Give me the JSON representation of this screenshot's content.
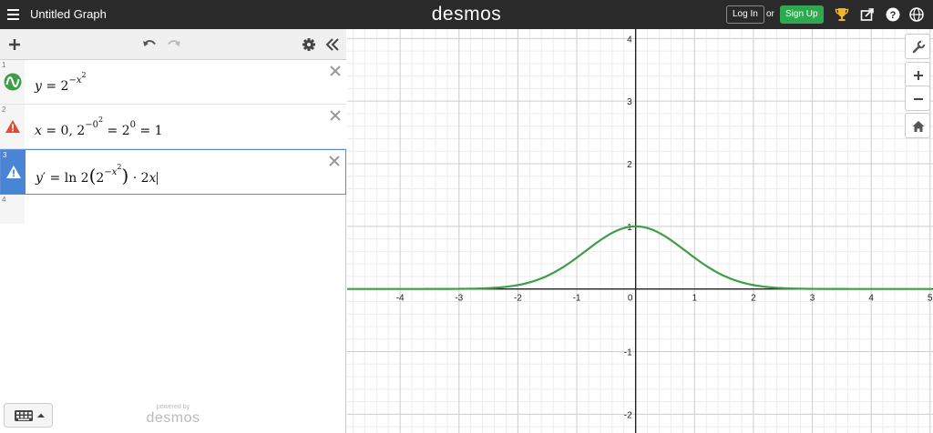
{
  "header": {
    "title": "Untitled Graph",
    "brand": "desmos",
    "login_label": "Log In",
    "or_text": "or",
    "signup_label": "Sign Up",
    "icons": [
      "menu-icon",
      "trophy-icon",
      "share-icon",
      "help-icon",
      "globe-icon"
    ]
  },
  "toolbar": {
    "icons": [
      "add-icon",
      "undo-icon",
      "redo-icon",
      "settings-icon",
      "collapse-icon"
    ]
  },
  "expressions": [
    {
      "num": "1",
      "status": "graphed"
    },
    {
      "num": "2",
      "status": "warning"
    },
    {
      "num": "3",
      "status": "warning",
      "active": true
    },
    {
      "num": "4"
    }
  ],
  "footer": {
    "powered_by": "powered by",
    "brand": "desmos"
  },
  "graph": {
    "curve_color": "#3e9e47",
    "x_ticks": [
      "-4",
      "-3",
      "-2",
      "-1",
      "0",
      "1",
      "2",
      "3",
      "4",
      "5"
    ],
    "y_ticks": [
      "4",
      "3",
      "2",
      "1",
      "-1",
      "-2"
    ],
    "x_range": [
      -4.9,
      5.05
    ],
    "y_range": [
      -2.3,
      4.15
    ]
  },
  "controls": {
    "icons": [
      "wrench-icon",
      "zoom-in-icon",
      "zoom-out-icon",
      "home-icon"
    ]
  },
  "colors": {
    "header_bg": "#2a2a2a",
    "signup_bg": "#2fa84f",
    "active_blue": "#4a84d4",
    "warning_red": "#e04b2c"
  }
}
